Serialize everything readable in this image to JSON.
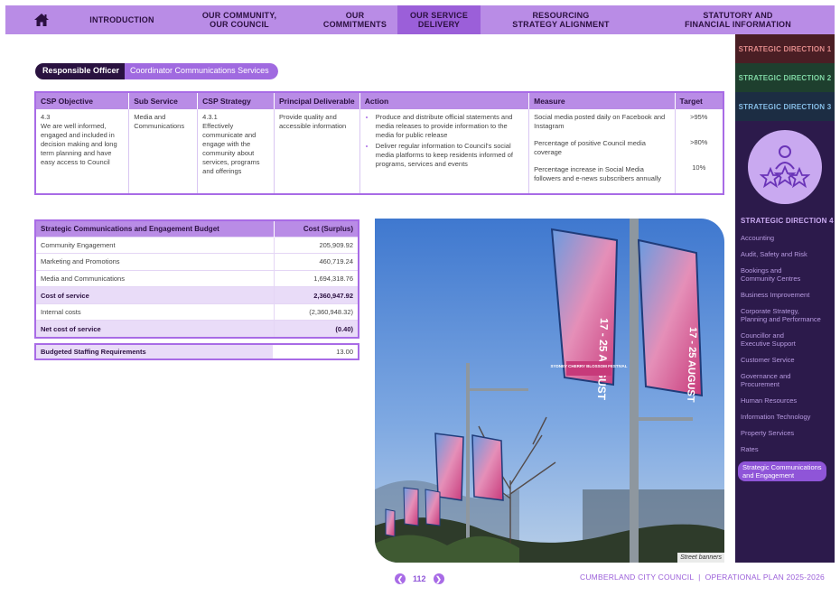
{
  "nav": {
    "items": [
      {
        "label": "INTRODUCTION"
      },
      {
        "label": "OUR COMMUNITY,\nOUR COUNCIL"
      },
      {
        "label": "OUR\nCOMMITMENTS"
      },
      {
        "label": "OUR SERVICE\nDELIVERY"
      },
      {
        "label": "RESOURCING\nSTRATEGY ALIGNMENT"
      },
      {
        "label": "STATUTORY AND\nFINANCIAL INFORMATION"
      }
    ]
  },
  "officer": {
    "label": "Responsible Officer",
    "value": "Coordinator Communications Services"
  },
  "csp": {
    "headers": [
      "CSP Objective",
      "Sub Service",
      "CSP Strategy",
      "Principal Deliverable",
      "Action",
      "Measure",
      "Target"
    ],
    "objective_code": "4.3",
    "objective_text": "We are well informed, engaged and included in decision making and long term planning and have easy access to Council",
    "sub_service": "Media and Communications",
    "strategy_code": "4.3.1",
    "strategy_text": "Effectively communicate and engage with the community about services, programs and offerings",
    "deliverable": "Provide quality and accessible information",
    "actions": [
      "Produce and distribute official statements and media releases to provide information to the media for public release",
      "Deliver regular information to Council's social media platforms to keep residents informed of programs, services and events"
    ],
    "measures": [
      "Social media posted daily on Facebook and Instagram",
      "Percentage of positive Council media coverage",
      "Percentage increase in Social Media followers and e-news subscribers annually"
    ],
    "targets": [
      ">95%",
      ">80%",
      "10%"
    ]
  },
  "budget": {
    "headers": [
      "Strategic Communications and Engagement Budget",
      "Cost (Surplus)"
    ],
    "rows": [
      {
        "label": "Community Engagement",
        "value": "205,909.92"
      },
      {
        "label": "Marketing and Promotions",
        "value": "460,719.24"
      },
      {
        "label": "Media and Communications",
        "value": "1,694,318.76"
      },
      {
        "label": "Cost of service",
        "value": "2,360,947.92"
      },
      {
        "label": "Internal costs",
        "value": "(2,360,948.32)"
      },
      {
        "label": "Net cost of service",
        "value": "(0.40)"
      }
    ],
    "staffing_label": "Budgeted Staffing Requirements",
    "staffing_value": "13.00"
  },
  "photo": {
    "caption": "Street banners",
    "banner_date": "17 - 25 AUGUST",
    "banner_title": "SYDNEY CHERRY BLOSSOM FESTIVAL"
  },
  "sidebar": {
    "directions": [
      "STRATEGIC DIRECTION 1",
      "STRATEGIC DIRECTION 2",
      "STRATEGIC DIRECTION 3",
      "STRATEGIC DIRECTION 4"
    ],
    "items": [
      "Accounting",
      "Audit, Safety and Risk",
      "Bookings and\nCommunity Centres",
      "Business Improvement",
      "Corporate Strategy,\nPlanning and Performance",
      "Councillor and\nExecutive Support",
      "Customer Service",
      "Governance and\nProcurement",
      "Human Resources",
      "Information Technology",
      "Property Services",
      "Rates",
      "Strategic Communications\nand Engagement"
    ]
  },
  "footer": {
    "page": "112",
    "text": "CUMBERLAND CITY COUNCIL  |  OPERATIONAL PLAN 2025-2026"
  },
  "colors": {
    "accent": "#b98ce6",
    "dark": "#2c1a4b",
    "highlight": "#8f55d8"
  }
}
